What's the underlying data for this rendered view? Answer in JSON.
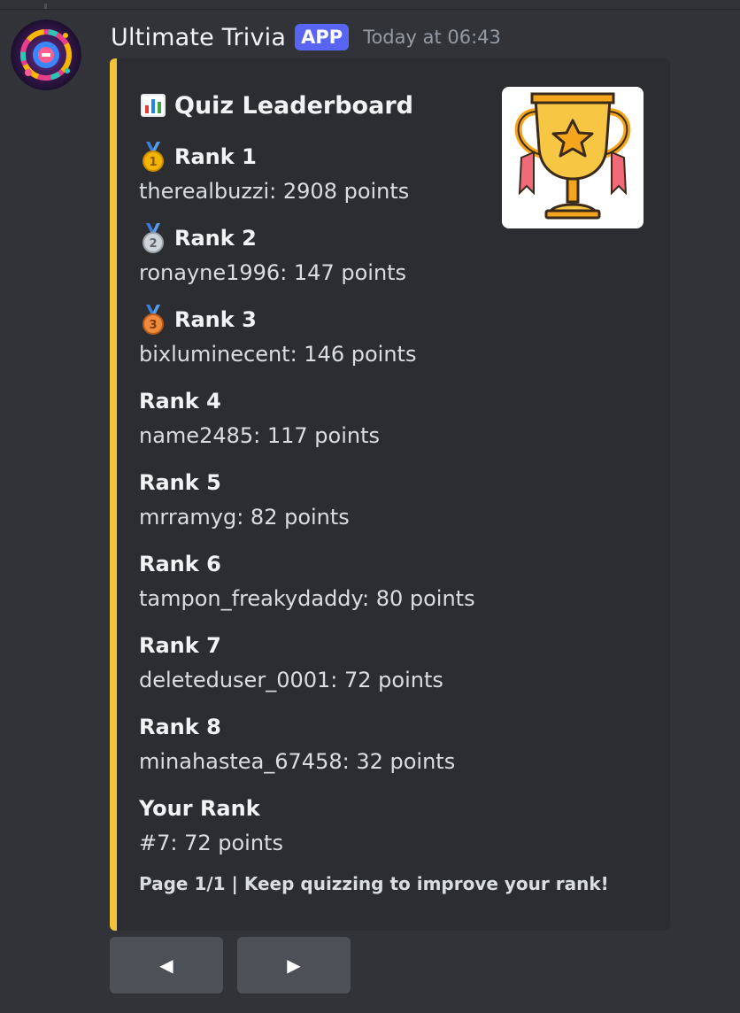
{
  "message": {
    "author": "Ultimate Trivia",
    "badge": "APP",
    "timestamp": "Today at 06:43"
  },
  "embed": {
    "accent_color": "#f2c436",
    "title": "Quiz Leaderboard",
    "title_icon": "bar-chart-emoji",
    "thumbnail_icon": "trophy-icon",
    "fields": [
      {
        "name": "Rank 1",
        "value": "therealbuzzi: 2908 points",
        "icon": "gold-medal-icon"
      },
      {
        "name": "Rank 2",
        "value": "ronayne1996: 147 points",
        "icon": "silver-medal-icon"
      },
      {
        "name": "Rank 3",
        "value": "bixluminecent: 146 points",
        "icon": "bronze-medal-icon"
      },
      {
        "name": "Rank 4",
        "value": "name2485: 117 points"
      },
      {
        "name": "Rank 5",
        "value": "mrramyg: 82 points"
      },
      {
        "name": "Rank 6",
        "value": "tampon_freakydaddy: 80 points"
      },
      {
        "name": "Rank 7",
        "value": "deleteduser_0001: 72 points"
      },
      {
        "name": "Rank 8",
        "value": "minahastea_67458: 32 points"
      },
      {
        "name": "Your Rank",
        "value": "#7: 72 points"
      }
    ],
    "footer": "Page 1/1 | Keep quizzing to improve your rank!"
  },
  "buttons": {
    "prev_label": "◀",
    "next_label": "▶"
  }
}
